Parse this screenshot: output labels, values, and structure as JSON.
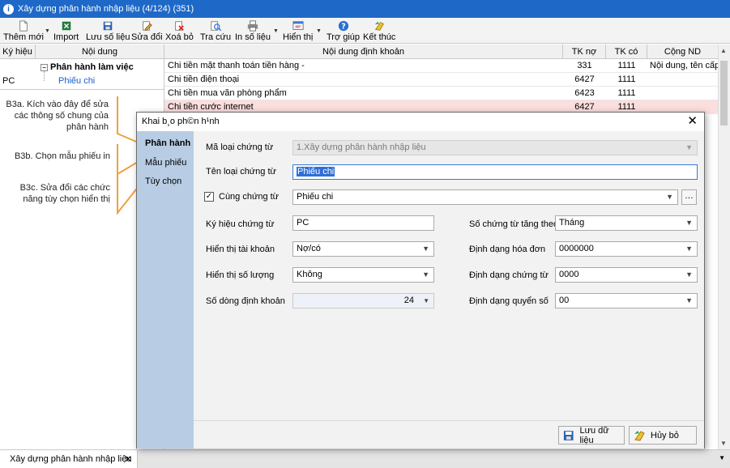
{
  "window": {
    "title": "Xây dựng phân hành nhập liệu (4/124) (351)"
  },
  "toolbar": {
    "buttons": [
      {
        "label": "Thêm mới",
        "icon": "new-document-icon"
      },
      {
        "label": "Import",
        "icon": "excel-import-icon"
      },
      {
        "label": "Lưu số liệu",
        "icon": "save-icon"
      },
      {
        "label": "Sửa đổi",
        "icon": "edit-icon"
      },
      {
        "label": "Xoá bỏ",
        "icon": "delete-icon"
      },
      {
        "label": "Tra cứu",
        "icon": "search-icon"
      },
      {
        "label": "In số liệu",
        "icon": "printer-icon"
      },
      {
        "label": "Hiển thị",
        "icon": "display-icon"
      },
      {
        "label": "Trợ giúp",
        "icon": "help-icon"
      },
      {
        "label": "Kết thúc",
        "icon": "exit-icon"
      }
    ]
  },
  "left_panel": {
    "headers": [
      "Ký hiệu",
      "Nội dung"
    ],
    "group_label": "Phân hành làm việc",
    "rows": [
      {
        "code": "PC",
        "name": "Phiếu chi"
      }
    ]
  },
  "grid": {
    "headers": [
      "Nội dung định khoản",
      "TK nợ",
      "TK có",
      "Cộng ND"
    ],
    "rows": [
      {
        "content": "Chi tiền mặt thanh toán tiền hàng -",
        "debit": "331",
        "credit": "1111",
        "extra": "Nội dung, tên cấp"
      },
      {
        "content": "Chi tiền điện thoại",
        "debit": "6427",
        "credit": "1111",
        "extra": ""
      },
      {
        "content": "Chi tiền mua văn phòng phẩm",
        "debit": "6423",
        "credit": "1111",
        "extra": ""
      },
      {
        "content": "Chi tiền cước internet",
        "debit": "6427",
        "credit": "1111",
        "extra": ""
      }
    ]
  },
  "annotations": [
    "B3a. Kích vào đây để sửa các thông số chung của phân hành",
    "B3b. Chọn mẫu phiếu in",
    "B3c. Sửa đổi các chức năng tùy chọn hiển thị"
  ],
  "dialog": {
    "title": "Khai b¸o ph©n h¹nh",
    "nav": [
      "Phân hành",
      "Mẫu phiếu",
      "Tùy chọn"
    ],
    "fields": {
      "ma_loai_label": "Mã loại chứng từ",
      "ma_loai_value": "1.Xây dựng phân hành nhập liệu",
      "ten_loai_label": "Tên loại chứng từ",
      "ten_loai_value": "Phiếu chi",
      "cung_label": "Cùng chứng từ",
      "cung_value": "Phiếu chi",
      "cung_checked": true,
      "ky_hieu_label": "Ký hiệu chứng từ",
      "ky_hieu_value": "PC",
      "hien_thi_tk_label": "Hiển thị tài khoản",
      "hien_thi_tk_value": "Nợ/có",
      "hien_thi_sl_label": "Hiển thị số lượng",
      "hien_thi_sl_value": "Không",
      "so_dong_label": "Số dòng định khoản",
      "so_dong_value": "24",
      "so_ct_tang_label": "Số chứng từ tăng theo",
      "so_ct_tang_value": "Tháng",
      "dd_hoa_don_label": "Định dạng hóa đơn",
      "dd_hoa_don_value": "0000000",
      "dd_chung_tu_label": "Định dạng chứng từ",
      "dd_chung_tu_value": "0000",
      "dd_quyen_so_label": "Định dạng quyển số",
      "dd_quyen_so_value": "00"
    },
    "buttons": {
      "save": "Lưu dữ liệu",
      "cancel": "Hủy bỏ"
    }
  },
  "bottom_tab": {
    "label": "Xây dựng phân hành nhập liệu"
  },
  "colors": {
    "titlebar": "#1e69c8",
    "nav": "#b8cde4",
    "selected_row": "#fbdede",
    "annotation_line": "#f0a040"
  }
}
